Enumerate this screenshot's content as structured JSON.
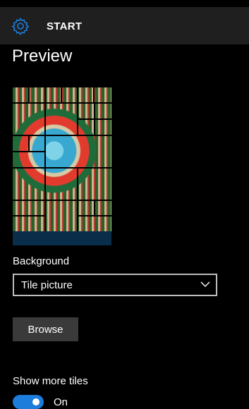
{
  "header": {
    "title": "START",
    "settings_icon": "gear-icon",
    "accent": "#1c7ddb"
  },
  "preview": {
    "title": "Preview"
  },
  "background": {
    "label": "Background",
    "selected": "Tile picture",
    "dropdown_icon": "chevron-down-icon"
  },
  "browse": {
    "label": "Browse"
  },
  "show_more_tiles": {
    "label": "Show more tiles",
    "state": "On",
    "enabled": true
  }
}
